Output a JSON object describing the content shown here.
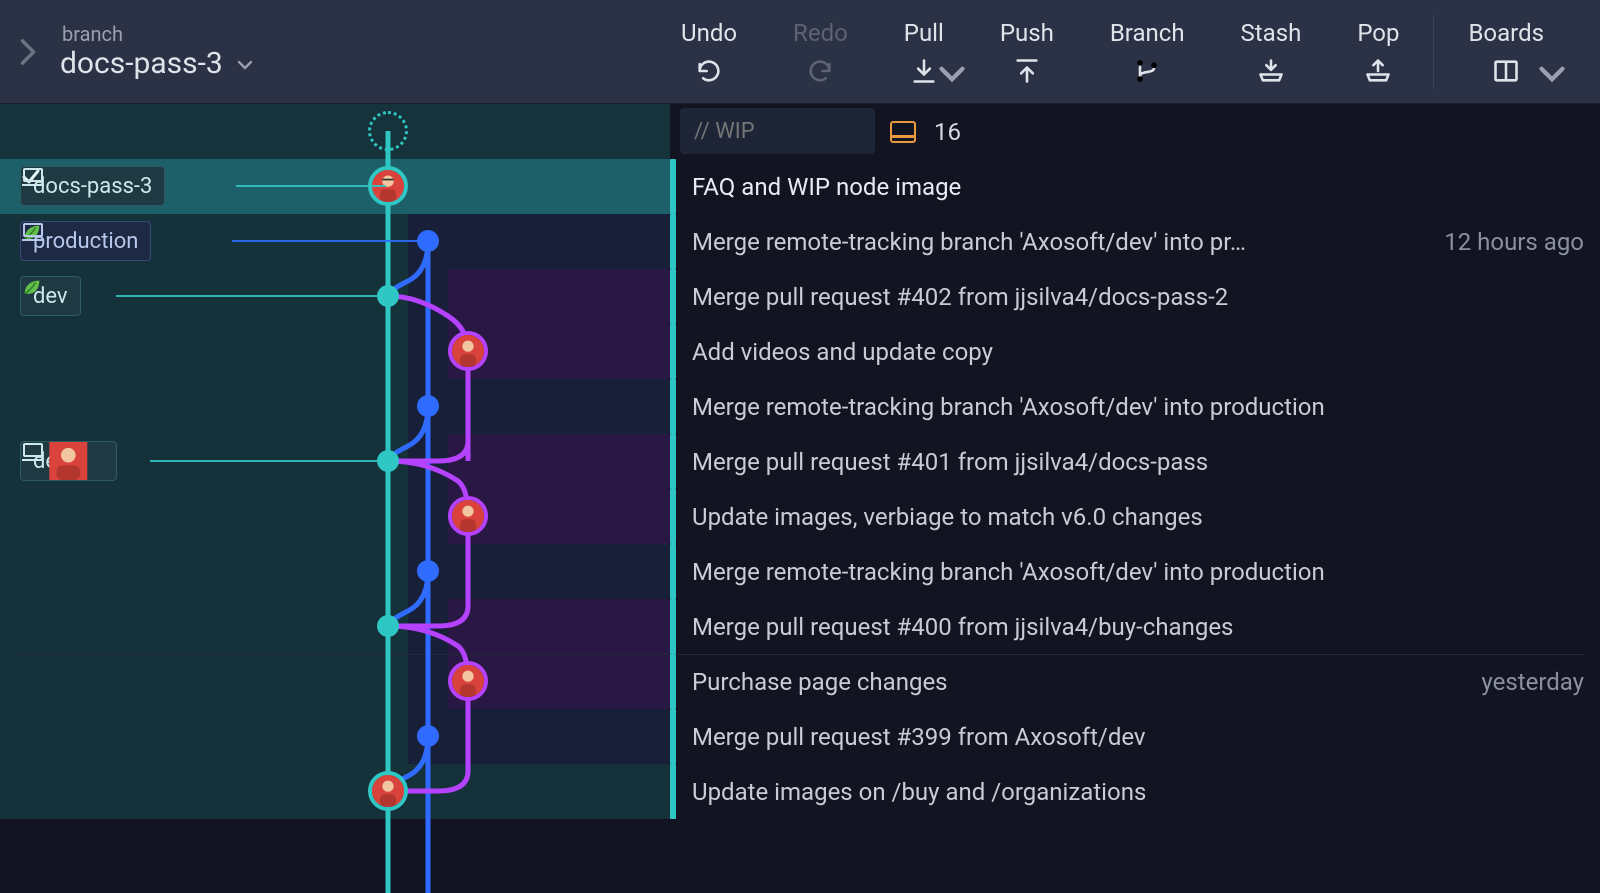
{
  "toolbar": {
    "branch_label": "branch",
    "branch_name": "docs-pass-3",
    "actions": {
      "undo": "Undo",
      "redo": "Redo",
      "pull": "Pull",
      "push": "Push",
      "branch": "Branch",
      "stash": "Stash",
      "pop": "Pop",
      "boards": "Boards"
    }
  },
  "wip": {
    "placeholder": "// WIP",
    "count": "16"
  },
  "branch_pills": {
    "p0": "docs-pass-3",
    "p1": "production",
    "p2": "dev",
    "p3": "dev"
  },
  "commits": {
    "c1": {
      "message": "FAQ and WIP node image",
      "time": ""
    },
    "c2": {
      "message": "Merge remote-tracking branch 'Axosoft/dev' into pr…",
      "time": "12 hours ago"
    },
    "c3": {
      "message": "Merge pull request #402 from jjsilva4/docs-pass-2",
      "time": ""
    },
    "c4": {
      "message": "Add videos and update copy",
      "time": ""
    },
    "c5": {
      "message": "Merge remote-tracking branch 'Axosoft/dev' into production",
      "time": ""
    },
    "c6": {
      "message": "Merge pull request #401 from jjsilva4/docs-pass",
      "time": ""
    },
    "c7": {
      "message": "Update images, verbiage to match v6.0 changes",
      "time": ""
    },
    "c8": {
      "message": "Merge remote-tracking branch 'Axosoft/dev' into production",
      "time": ""
    },
    "c9": {
      "message": "Merge pull request #400 from jjsilva4/buy-changes",
      "time": ""
    },
    "c10": {
      "message": "Purchase page changes",
      "time": "yesterday"
    },
    "c11": {
      "message": "Merge pull request #399 from Axosoft/dev",
      "time": ""
    },
    "c12": {
      "message": "Update images on /buy and /organizations",
      "time": ""
    }
  },
  "colors": {
    "teal": "#2fc7c4",
    "blue": "#2f6bff",
    "purple": "#b542ff",
    "orange": "#e89a3c"
  }
}
